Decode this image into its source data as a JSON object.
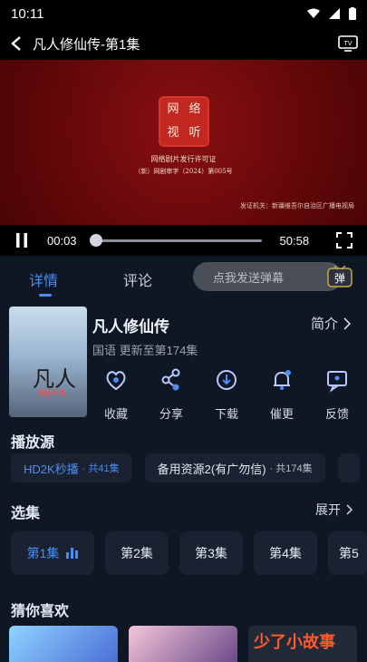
{
  "status_bar": {
    "time": "10:11"
  },
  "header": {
    "title": "凡人修仙传-第1集"
  },
  "video": {
    "seal_chars": [
      "网",
      "络",
      "视",
      "听"
    ],
    "license_line1": "网络剧片发行许可证",
    "license_line2": "（新）网剧审字（2024）第005号",
    "issuer": "发证机关：新疆维吾尔自治区广播电视局"
  },
  "player": {
    "current_time": "00:03",
    "duration": "50:58",
    "progress": 0.001
  },
  "tabs": {
    "details": "详情",
    "comments": "评论"
  },
  "danmu": {
    "placeholder": "点我发送弹幕",
    "icon_label": "弹"
  },
  "poster": {
    "big_text": "凡人",
    "small_text": "风起天南"
  },
  "show": {
    "title": "凡人修仙传",
    "intro_label": "简介",
    "meta": "国语 更新至第174集"
  },
  "actions": [
    {
      "label": "收藏",
      "icon": "heart-icon"
    },
    {
      "label": "分享",
      "icon": "share-icon"
    },
    {
      "label": "下载",
      "icon": "download-icon"
    },
    {
      "label": "催更",
      "icon": "bell-icon"
    },
    {
      "label": "反馈",
      "icon": "feedback-icon"
    }
  ],
  "sources": {
    "title": "播放源",
    "items": [
      {
        "name": "HD2K秒播",
        "count": "· 共41集"
      },
      {
        "name": "备用资源2(有广勿信)",
        "count": "· 共174集"
      }
    ]
  },
  "episodes": {
    "title": "选集",
    "expand_label": "展开",
    "items": [
      "第1集",
      "第2集",
      "第3集",
      "第4集",
      "第5"
    ]
  },
  "recommend": {
    "title": "猜你喜欢",
    "overlay_text": "少了小故事"
  },
  "colors": {
    "accent": "#4b8df5",
    "background": "#0f1725",
    "card": "#1a2232"
  }
}
